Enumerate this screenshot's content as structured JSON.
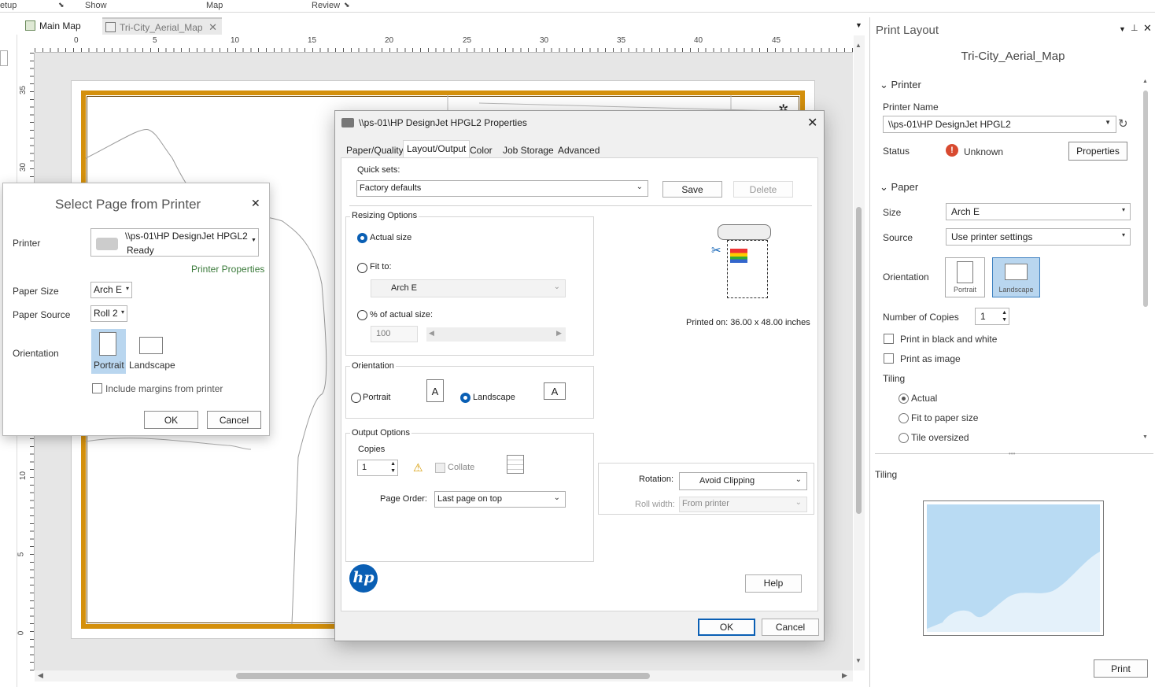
{
  "ribbon": {
    "groups": [
      "etup",
      "Show",
      "Map",
      "Review"
    ]
  },
  "tabs": [
    {
      "label": "Main Map"
    },
    {
      "label": "Tri-City_Aerial_Map"
    }
  ],
  "ruler": {
    "top": [
      "0",
      "5",
      "10",
      "15",
      "20",
      "25",
      "30",
      "35",
      "40",
      "45"
    ],
    "left": [
      "35",
      "30",
      "10",
      "5",
      "0"
    ]
  },
  "select_dialog": {
    "title": "Select Page from Printer",
    "printer_label": "Printer",
    "printer_name": "\\\\ps-01\\HP DesignJet HPGL2",
    "printer_status": "Ready",
    "printer_properties_link": "Printer Properties",
    "paper_size_label": "Paper Size",
    "paper_size": "Arch E",
    "paper_source_label": "Paper Source",
    "paper_source": "Roll 2",
    "orientation_label": "Orientation",
    "portrait": "Portrait",
    "landscape": "Landscape",
    "include_margins": "Include margins from printer",
    "ok": "OK",
    "cancel": "Cancel"
  },
  "hp_dialog": {
    "title": "\\\\ps-01\\HP DesignJet HPGL2 Properties",
    "tabs": [
      "Paper/Quality",
      "Layout/Output",
      "Color",
      "Job Storage",
      "Advanced"
    ],
    "quick_sets_label": "Quick sets:",
    "quick_set": "Factory defaults",
    "save": "Save",
    "delete": "Delete",
    "resizing_title": "Resizing Options",
    "actual_size": "Actual size",
    "fit_to": "Fit to:",
    "fit_to_value": "Arch E",
    "pct_actual": "% of actual size:",
    "pct_value": "100",
    "printed_on": "Printed on: 36.00 x 48.00 inches",
    "orientation_title": "Orientation",
    "portrait": "Portrait",
    "landscape": "Landscape",
    "glyph": "A",
    "output_title": "Output Options",
    "copies_label": "Copies",
    "copies": "1",
    "collate": "Collate",
    "page_order_label": "Page Order:",
    "page_order": "Last page on top",
    "rotation_label": "Rotation:",
    "rotation": "Avoid Clipping",
    "roll_width_label": "Roll width:",
    "roll_width": "From printer",
    "help": "Help",
    "ok": "OK",
    "cancel": "Cancel",
    "logo": "hp"
  },
  "print_pane": {
    "title": "Print Layout",
    "layout_name": "Tri-City_Aerial_Map",
    "printer_section": "Printer",
    "printer_name_label": "Printer Name",
    "printer_name": "\\\\ps-01\\HP DesignJet HPGL2",
    "status_label": "Status",
    "status": "Unknown",
    "properties": "Properties",
    "paper_section": "Paper",
    "size_label": "Size",
    "size": "Arch E",
    "source_label": "Source",
    "source": "Use printer settings",
    "orientation_label": "Orientation",
    "portrait": "Portrait",
    "landscape": "Landscape",
    "copies_label": "Number of Copies",
    "copies": "1",
    "print_bw": "Print in black and white",
    "print_image": "Print as image",
    "tiling_label": "Tiling",
    "tiling_actual": "Actual",
    "tiling_fit": "Fit to paper size",
    "tiling_over": "Tile oversized",
    "tiling_preview_label": "Tiling",
    "print": "Print"
  },
  "colors": {
    "frame": "#d4900c",
    "accent": "#0a5fb4",
    "selected": "#b9d6ef",
    "water": "#b9dbf3"
  }
}
